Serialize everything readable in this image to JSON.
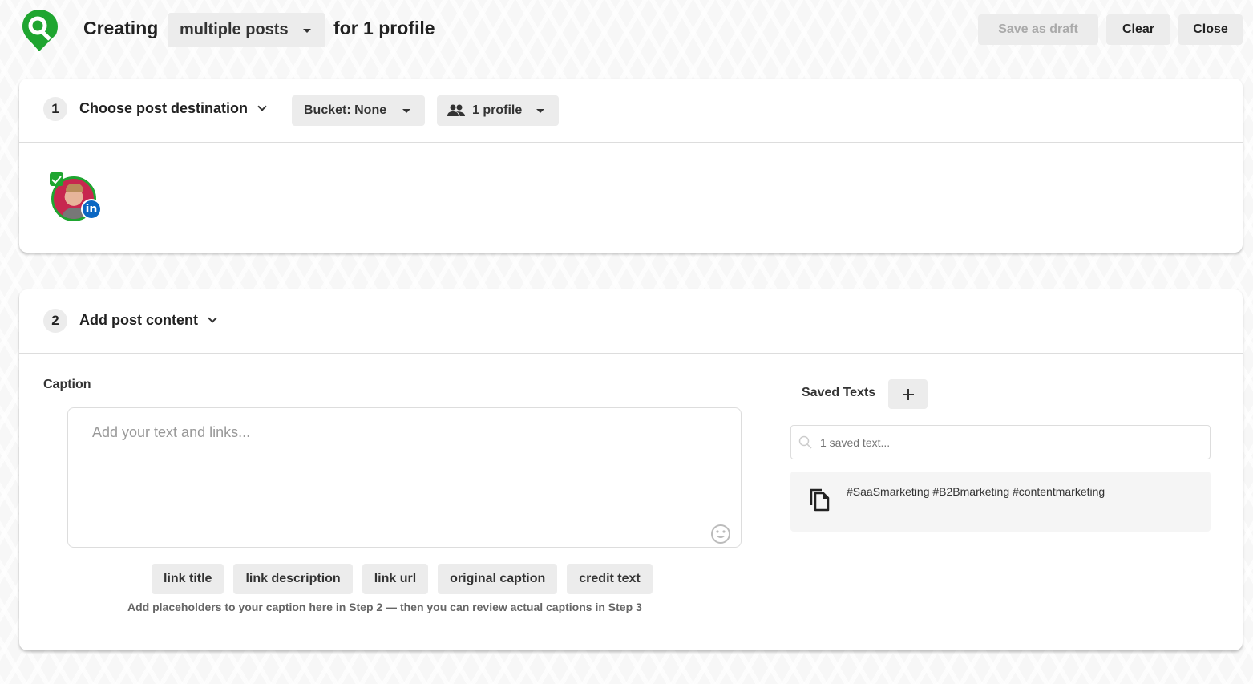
{
  "header": {
    "creating_label": "Creating",
    "mode_select": "multiple posts",
    "for_label": "for 1 profile",
    "save_draft": "Save as draft",
    "clear": "Clear",
    "close": "Close"
  },
  "step1": {
    "number": "1",
    "title": "Choose post destination",
    "bucket_select": "Bucket: None",
    "profile_select": "1 profile",
    "profiles": [
      {
        "network": "linkedin",
        "network_badge": "in",
        "selected": true
      }
    ]
  },
  "step2": {
    "number": "2",
    "title": "Add post content",
    "caption_label": "Caption",
    "caption_value": "",
    "caption_placeholder": "Add your text and links...",
    "placeholder_buttons": [
      "link title",
      "link description",
      "link url",
      "original caption",
      "credit text"
    ],
    "hint": "Add placeholders to your caption here in Step 2 — then you can review actual captions in Step 3",
    "saved_texts": {
      "title": "Saved Texts",
      "search_placeholder": "1 saved text...",
      "items": [
        "#SaaSmarketing #B2Bmarketing #contentmarketing"
      ]
    }
  },
  "colors": {
    "brand_green": "#1fa530",
    "linkedin_blue": "#0a66c2"
  }
}
